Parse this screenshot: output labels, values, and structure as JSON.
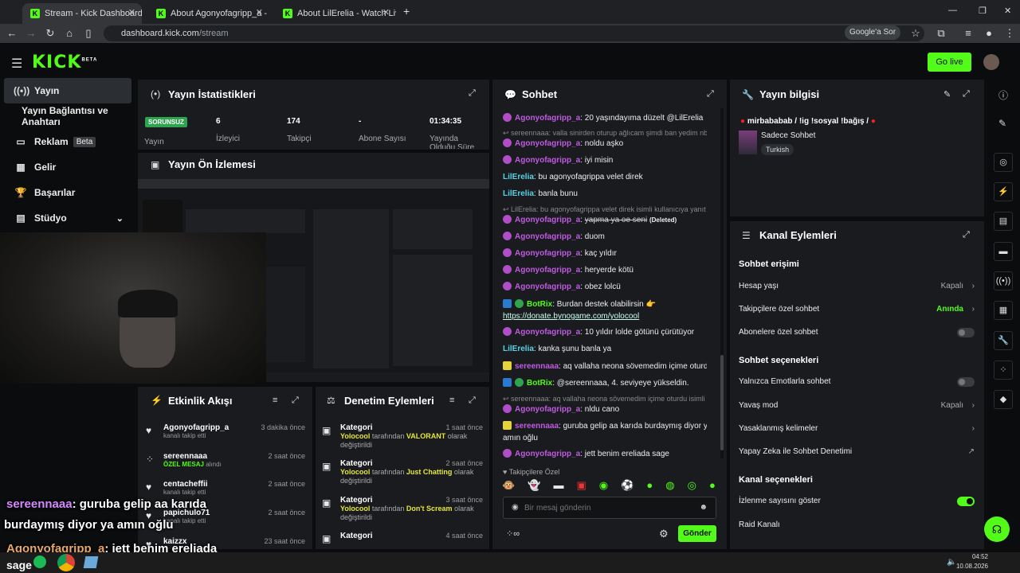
{
  "browser": {
    "tabs": [
      {
        "label": "Stream - Kick Dashboard"
      },
      {
        "label": "About Agonyofagripp_a - Watc"
      },
      {
        "label": "About LilErelia - Watch Live on"
      }
    ],
    "url_host": "dashboard.kick.com",
    "url_path": "/stream",
    "google_btn": "Google'a Sor"
  },
  "header": {
    "logo": "KICK",
    "logo_beta": "BETA",
    "golive": "Go live"
  },
  "sidebar": {
    "items": [
      {
        "label": "Yayın"
      },
      {
        "label": "Yayın Bağlantısı ve Anahtarı"
      },
      {
        "label": "Reklam",
        "badge": "Beta"
      },
      {
        "label": "Gelir"
      },
      {
        "label": "Başarılar"
      },
      {
        "label": "Stüdyo"
      }
    ]
  },
  "stats": {
    "title": "Yayın İstatistikleri",
    "status_badge": "SORUNSUZ",
    "status_label": "Yayın",
    "items": [
      {
        "value": "6",
        "label": "İzleyici"
      },
      {
        "value": "174",
        "label": "Takipçi"
      },
      {
        "value": "-",
        "label": "Abone Sayısı"
      },
      {
        "value": "01:34:35",
        "label": "Yayında Olduğu Süre"
      }
    ]
  },
  "preview": {
    "title": "Yayın Ön İzlemesi"
  },
  "activity": {
    "title": "Etkinlik Akışı",
    "rows": [
      {
        "name": "Agonyofagripp_a",
        "sub": "kanalı takip etti",
        "time": "3 dakika önce"
      },
      {
        "name": "sereennaaa",
        "sub_hl": "ÖZEL MESAJ",
        "sub": "alındı",
        "time": "2 saat önce"
      },
      {
        "name": "centacheffii",
        "sub": "kanalı takip etti",
        "time": "2 saat önce"
      },
      {
        "name": "papichulo71",
        "sub": "kanalı takip etti",
        "time": "2 saat önce"
      },
      {
        "name": "kaizzx",
        "sub": "",
        "time": "23 saat önce"
      }
    ]
  },
  "moderation": {
    "title": "Denetim Eylemleri",
    "rows": [
      {
        "title": "Kategori",
        "time": "1 saat önce",
        "user": "Yolocool",
        "mid": "tarafından",
        "cat": "VALORANT",
        "end": "olarak değiştirildi"
      },
      {
        "title": "Kategori",
        "time": "2 saat önce",
        "user": "Yolocool",
        "mid": "tarafından",
        "cat": "Just Chatting",
        "end": "olarak değiştirildi"
      },
      {
        "title": "Kategori",
        "time": "3 saat önce",
        "user": "Yolocool",
        "mid": "tarafından",
        "cat": "Don't Scream",
        "end": "olarak değiştirildi"
      },
      {
        "title": "Kategori",
        "time": "4 saat önce",
        "user": "",
        "mid": "",
        "cat": "",
        "end": ""
      }
    ]
  },
  "chat": {
    "title": "Sohbet",
    "messages": [
      {
        "user": "Agonyofagripp_a",
        "color": "#c05be0",
        "text": "20 yaşındayıma düzelt @LilErelia",
        "badge": "purple"
      },
      {
        "system": "sereennaaa: valla sinirden oturup ağlıcam şimdi ban yedim nbo..."
      },
      {
        "user": "Agonyofagripp_a",
        "color": "#c05be0",
        "text": "noldu aşko",
        "badge": "purple"
      },
      {
        "user": "Agonyofagripp_a",
        "color": "#c05be0",
        "text": "iyi misin",
        "badge": "purple"
      },
      {
        "user": "LilErelia",
        "color": "#5ad2e6",
        "text": "bu agonyofagrippa velet direk",
        "badge": ""
      },
      {
        "user": "LilErelia",
        "color": "#5ad2e6",
        "text": "banla bunu",
        "badge": ""
      },
      {
        "system": "LilErelia: bu agonyofagrippa velet direk isimli kullanıcıya yanıt v..."
      },
      {
        "user": "Agonyofagripp_a",
        "color": "#c05be0",
        "text": "yapma ya oe seni",
        "deleted": "(Deleted)",
        "badge": "purple"
      },
      {
        "user": "Agonyofagripp_a",
        "color": "#c05be0",
        "text": "duom",
        "badge": "purple"
      },
      {
        "user": "Agonyofagripp_a",
        "color": "#c05be0",
        "text": "kaç yıldır",
        "badge": "purple"
      },
      {
        "user": "Agonyofagripp_a",
        "color": "#c05be0",
        "text": "heryerde kötü",
        "badge": "purple"
      },
      {
        "user": "Agonyofagripp_a",
        "color": "#c05be0",
        "text": "obez lolcü",
        "badge": "purple"
      },
      {
        "user": "BotRix",
        "color": "#53fc18",
        "text": "Burdan destek olabilirsin 👉",
        "badge": "bot"
      },
      {
        "link": "https://donate.bynogame.com/yolocool"
      },
      {
        "user": "Agonyofagripp_a",
        "color": "#c05be0",
        "text": "10 yıldır lolde götünü çürütüyor",
        "badge": "purple"
      },
      {
        "user": "LilErelia",
        "color": "#5ad2e6",
        "text": "kanka şunu banla ya",
        "badge": ""
      },
      {
        "user": "sereennaaa",
        "color": "#c05be0",
        "text": "aq vallaha neona sövemedim içime oturdu",
        "badge": "yellow"
      },
      {
        "user": "BotRix",
        "color": "#53fc18",
        "text": "@sereennaaa, 4. seviyeye yükseldin.",
        "badge": "bot"
      },
      {
        "system": "sereennaaa: aq vallaha neona sövemedim içime oturdu isimli k..."
      },
      {
        "user": "Agonyofagripp_a",
        "color": "#c05be0",
        "text": "nldu cano",
        "badge": "purple"
      },
      {
        "user": "sereennaaa",
        "color": "#c05be0",
        "text": "guruba gelip aa karıda burdaymış diyor ya",
        "badge": "yellow"
      },
      {
        "cont": "amın oğlu"
      },
      {
        "user": "Agonyofagripp_a",
        "color": "#c05be0",
        "text": "jett benim ereliada sage",
        "badge": "purple"
      }
    ],
    "followers_only": "Takipçilere Özel",
    "input_placeholder": "Bir mesaj gönderin",
    "send": "Gönder"
  },
  "info": {
    "title": "Yayın bilgisi",
    "stream_title": "mirbababab / !ig !sosyal !bağış /",
    "category": "Sadece Sohbet",
    "language": "Turkish"
  },
  "actions": {
    "title": "Kanal Eylemleri",
    "sections": [
      {
        "title": "Sohbet erişimi"
      },
      {
        "title": "Sohbet seçenekleri"
      },
      {
        "title": "Kanal seçenekleri"
      }
    ],
    "rows": [
      {
        "label": "Hesap yaşı",
        "value": "Kapalı"
      },
      {
        "label": "Takipçilere özel sohbet",
        "value": "Anında"
      },
      {
        "label": "Abonelere özel sohbet",
        "value": ""
      },
      {
        "label": "Yalnızca Emotlarla sohbet",
        "value": ""
      },
      {
        "label": "Yavaş mod",
        "value": "Kapalı"
      },
      {
        "label": "Yasaklanmış kelimeler",
        "value": ""
      },
      {
        "label": "Yapay Zeka ile Sohbet Denetimi",
        "value": ""
      },
      {
        "label": "İzlenme sayısını göster",
        "value": ""
      },
      {
        "label": "Raid Kanalı",
        "value": ""
      }
    ]
  },
  "overlay": {
    "line1_user": "sereennaaa",
    "line1_text": ": guruba gelip aa karıda",
    "line2_text": "burdaymış diyor ya amın oğlu",
    "line3_user": "Agonyofagripp_a",
    "line3_text": ": jett benim ereliada",
    "line4_text": "sage"
  },
  "taskbar": {
    "time": "04:52",
    "date": "10.08.2026"
  }
}
